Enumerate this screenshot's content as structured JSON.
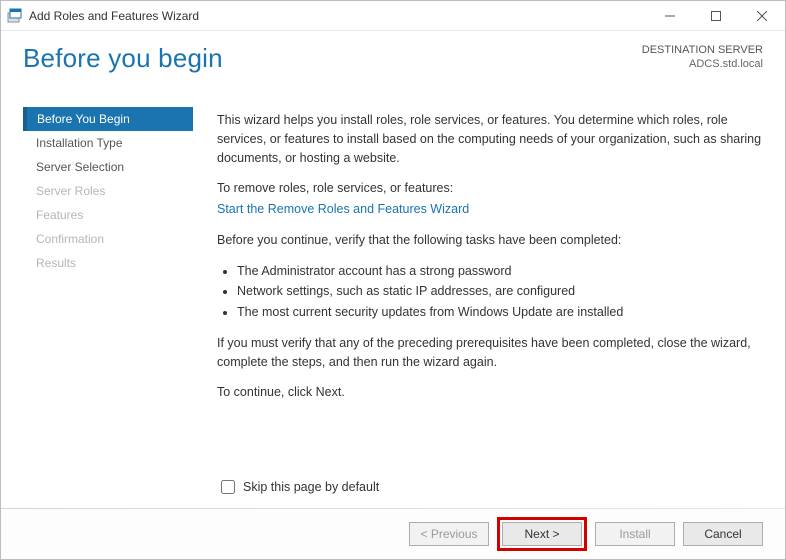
{
  "window": {
    "title": "Add Roles and Features Wizard"
  },
  "header": {
    "page_title": "Before you begin",
    "dest_label": "DESTINATION SERVER",
    "dest_server": "ADCS.std.local"
  },
  "sidebar": {
    "items": [
      {
        "label": "Before You Begin",
        "active": true,
        "disabled": false
      },
      {
        "label": "Installation Type",
        "active": false,
        "disabled": false
      },
      {
        "label": "Server Selection",
        "active": false,
        "disabled": false
      },
      {
        "label": "Server Roles",
        "active": false,
        "disabled": true
      },
      {
        "label": "Features",
        "active": false,
        "disabled": true
      },
      {
        "label": "Confirmation",
        "active": false,
        "disabled": true
      },
      {
        "label": "Results",
        "active": false,
        "disabled": true
      }
    ]
  },
  "content": {
    "intro": "This wizard helps you install roles, role services, or features. You determine which roles, role services, or features to install based on the computing needs of your organization, such as sharing documents, or hosting a website.",
    "remove_label": "To remove roles, role services, or features:",
    "remove_link": "Start the Remove Roles and Features Wizard",
    "verify_label": "Before you continue, verify that the following tasks have been completed:",
    "bullets": [
      "The Administrator account has a strong password",
      "Network settings, such as static IP addresses, are configured",
      "The most current security updates from Windows Update are installed"
    ],
    "verify_note": "If you must verify that any of the preceding prerequisites have been completed, close the wizard, complete the steps, and then run the wizard again.",
    "continue_note": "To continue, click Next.",
    "skip_label": "Skip this page by default"
  },
  "footer": {
    "previous": "< Previous",
    "next": "Next >",
    "install": "Install",
    "cancel": "Cancel"
  }
}
